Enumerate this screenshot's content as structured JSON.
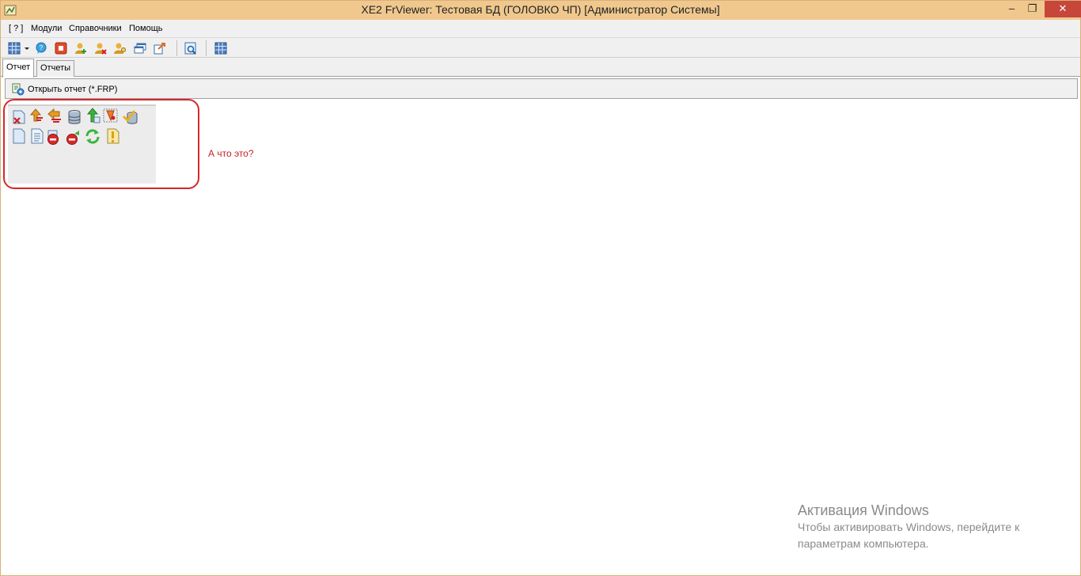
{
  "window": {
    "title": "XE2  FrViewer:   Тестовая БД (ГОЛОВКО ЧП) [Администратор Системы]",
    "controls": {
      "minimize": "‒",
      "maximize": "❐",
      "close": "✕"
    }
  },
  "menu": {
    "items": [
      "[ ? ]",
      "Модули",
      "Справочники",
      "Помощь"
    ]
  },
  "toolbar": {
    "icons": [
      "grid-dropdown-icon",
      "chat-icon",
      "stop-icon",
      "user-add-icon",
      "user-remove-icon",
      "key-users-icon",
      "windows-icon",
      "export-icon",
      "preview-icon",
      "table-icon"
    ]
  },
  "tabs": [
    {
      "label": "Отчет",
      "active": true
    },
    {
      "label": "Отчеты",
      "active": false
    }
  ],
  "page": {
    "open_report_label": "Открыть отчет (*.FRP)"
  },
  "icon_panel": {
    "row1": [
      "delete-doc-icon",
      "sort-icon",
      "sort-back-icon",
      "database-icon",
      "arrow-up-icon",
      "fire-icon",
      "check-icon"
    ],
    "row2": [
      "blank-doc-icon",
      "text-doc-icon",
      "stop-red-icon",
      "stop-arrow-icon",
      "refresh-icon",
      "warning-doc-icon"
    ]
  },
  "annotation": {
    "text": "А что это?",
    "color": "#c42128"
  },
  "activation": {
    "title": "Активация Windows",
    "line1": "Чтобы активировать Windows, перейдите к",
    "line2": "параметрам компьютера."
  },
  "colors": {
    "titlebar": "#f0c88e",
    "close_button": "#c7463a",
    "highlight": "#d8262a"
  }
}
